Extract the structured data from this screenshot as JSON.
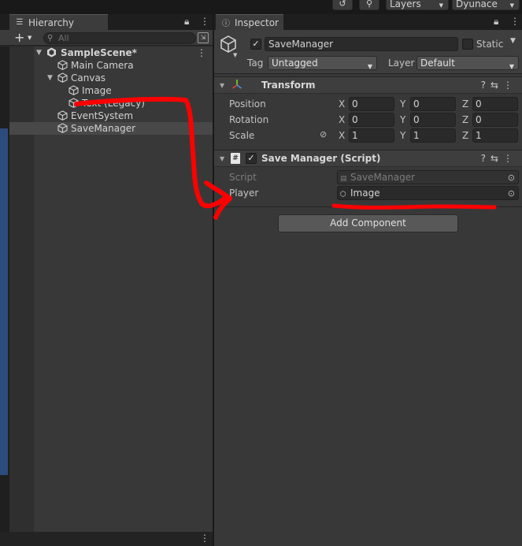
{
  "topbar": {
    "layers_label": "Layers",
    "layout_label": "Dyunace"
  },
  "hierarchy": {
    "tab_label": "Hierarchy",
    "search_placeholder": "All",
    "items": [
      {
        "label": "SampleScene*"
      },
      {
        "label": "Main Camera"
      },
      {
        "label": "Canvas"
      },
      {
        "label": "Image"
      },
      {
        "label": "Text (Legacy)"
      },
      {
        "label": "EventSystem"
      },
      {
        "label": "SaveManager"
      }
    ]
  },
  "inspector": {
    "tab_label": "Inspector",
    "gameobject": {
      "name": "SaveManager",
      "static_label": "Static",
      "tag_label": "Tag",
      "tag_value": "Untagged",
      "layer_label": "Layer",
      "layer_value": "Default"
    },
    "transform": {
      "title": "Transform",
      "position_label": "Position",
      "rotation_label": "Rotation",
      "scale_label": "Scale",
      "axes": [
        "X",
        "Y",
        "Z"
      ],
      "position": [
        "0",
        "0",
        "0"
      ],
      "rotation": [
        "0",
        "0",
        "0"
      ],
      "scale": [
        "1",
        "1",
        "1"
      ]
    },
    "script_component": {
      "title": "Save Manager (Script)",
      "script_label": "Script",
      "script_value": "SaveManager",
      "player_label": "Player",
      "player_value": "Image"
    },
    "add_component_label": "Add Component"
  },
  "colors": {
    "annotation": "#ff0000",
    "selection": "#484848",
    "scene_blue": "#2c4c7c"
  }
}
